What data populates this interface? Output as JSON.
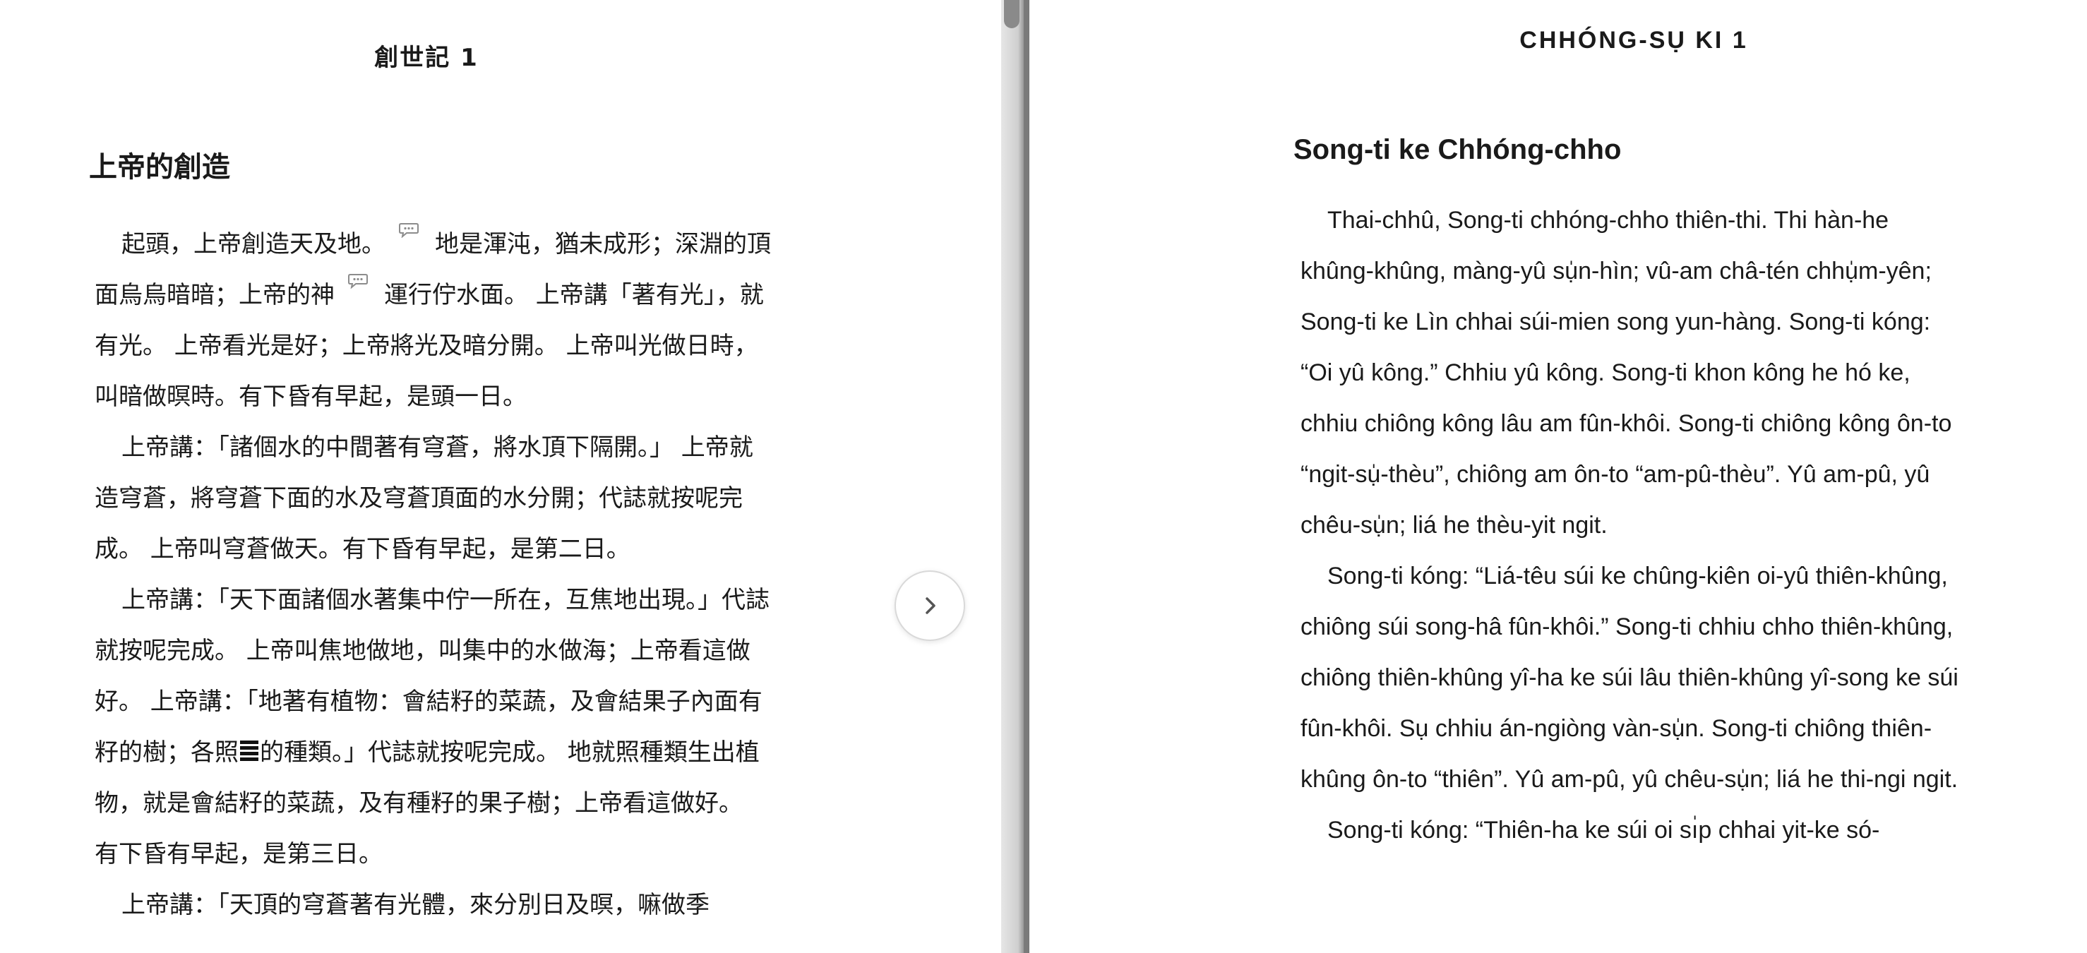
{
  "left": {
    "chapter_title": "創世記 1",
    "section_heading": "上帝的創造",
    "p1": {
      "a": "起頭，上帝創造天及地。",
      "b": "地是渾沌，猶未成形；深淵的頂面烏烏暗暗；上帝的神",
      "c": "運行佇水面。 上帝講「著有光」，就有光。 上帝看光是好；上帝將光及暗分開。 上帝叫光做日時，叫暗做暝時。有下昏有早起，是頭一日。"
    },
    "p2": "上帝講：「諸個水的中間著有穹蒼，將水頂下隔開。」 上帝就造穹蒼，將穹蒼下面的水及穹蒼頂面的水分開；代誌就按呢完成。 上帝叫穹蒼做天。有下昏有早起，是第二日。",
    "p3": {
      "a": "上帝講：「天下面諸個水著集中佇一所在，互焦地出現。」代誌就按呢完成。 上帝叫焦地做地，叫集中的水做海；上帝看這做好。 上帝講：「地著有植物：會結籽的菜蔬，及會結果子內面有籽的樹；各照",
      "b": "的種類。」代誌就按呢完成。 地就照種類生出植物，就是會結籽的菜蔬，及有種籽的果子樹；上帝看這做好。 有下昏有早起，是第三日。"
    },
    "p4": "上帝講：「天頂的穹蒼著有光體，來分別日及暝，嘛做季"
  },
  "right": {
    "chapter_title": "CHHÓNG-SỤ KI 1",
    "section_heading": "Song-ti ke Chhóng-chho",
    "p1": "Thai-chhû, Song-ti chhóng-chho thiên-thi. Thi hàn-he khûng-khûng, màng-yû sụ̍n-hìn; vû-am châ-tén chhụ̍m-yên; Song-ti ke Lìn chhai súi-mien song yun-hàng. Song-ti kóng: “Oi yû kông.” Chhiu yû kông. Song-ti khon kông he hó ke, chhiu chiông kông lâu am fûn-khôi. Song-ti chiông kông ôn-to “ngit-sụ̍-thèu”, chiông am ôn-to “am-pû-thèu”. Yû am-pû, yû chêu-sụ̍n; liá he thèu-yit ngit.",
    "p2": "Song-ti kóng: “Liá-têu súi ke chûng-kiên oi-yû thiên-khûng, chiông súi song-hâ fûn-khôi.” Song-ti chhiu chho thiên-khûng, chiông thiên-khûng yî-ha ke súi lâu thiên-khûng yî-song ke súi fûn-khôi. Sụ chhiu án-ngiòng vàn-sụ̍n. Song-ti chiông thiên-khûng ôn-to “thiên”. Yû am-pû, yû chêu-sụ̍n; liá he thi-ngi ngit.",
    "p3": "Song-ti kóng: “Thiên-ha ke súi oi sı̍p chhai yit-ke só-"
  },
  "icons": {
    "note": "speech-bubble-icon",
    "next": "chevron-right-icon"
  },
  "colors": {
    "text": "#1a1a1a",
    "icon": "#8c8c8c",
    "divider": "#7a7a7a"
  }
}
